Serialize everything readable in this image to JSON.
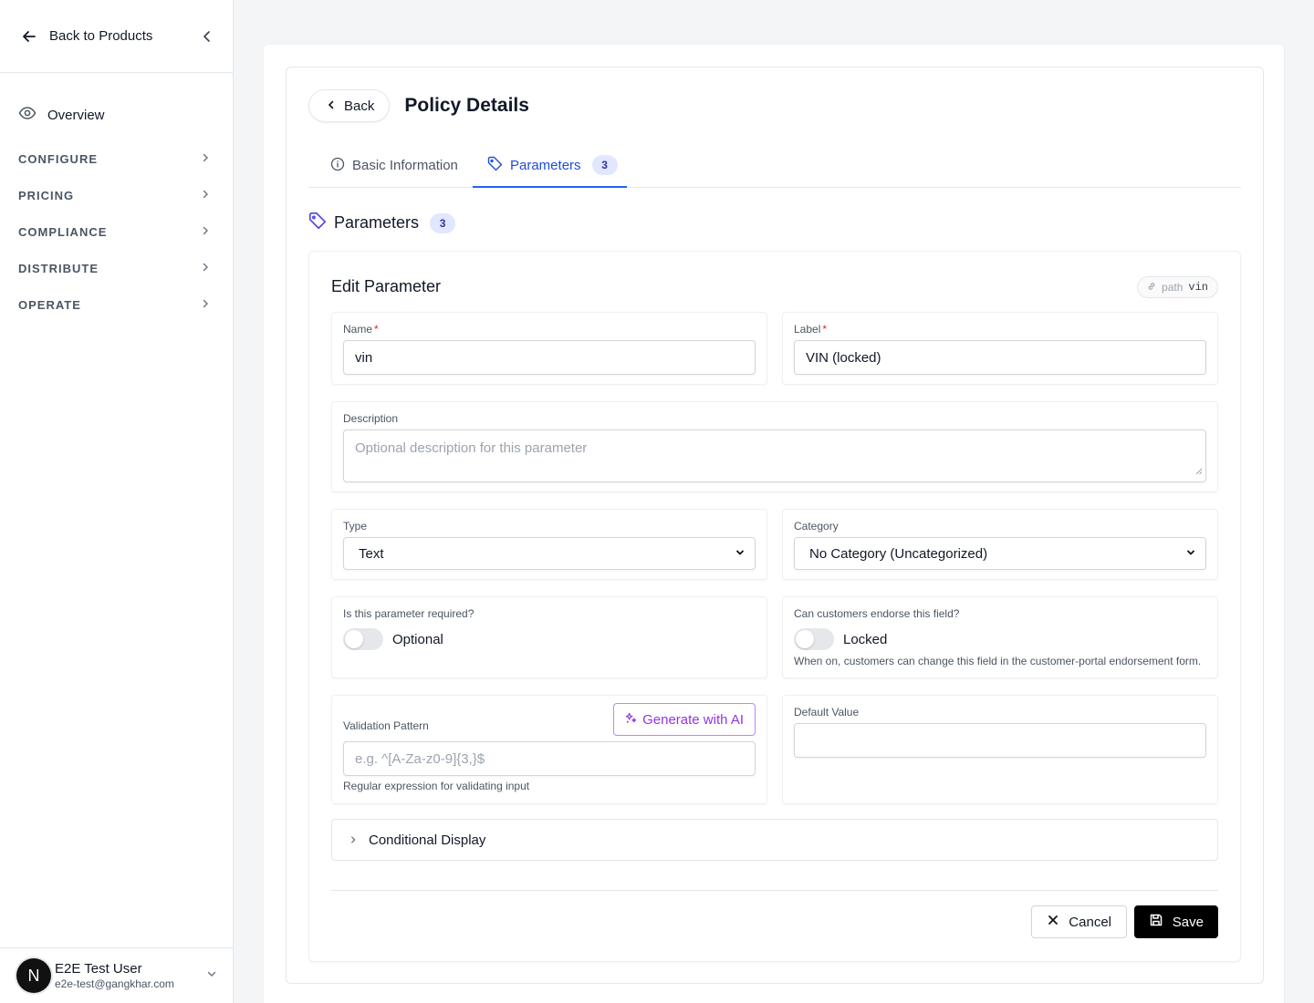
{
  "sidebar": {
    "back_label": "Back to Products",
    "overview_label": "Overview",
    "sections": [
      {
        "label": "CONFIGURE"
      },
      {
        "label": "PRICING"
      },
      {
        "label": "COMPLIANCE"
      },
      {
        "label": "DISTRIBUTE"
      },
      {
        "label": "OPERATE"
      }
    ],
    "user": {
      "initial": "N",
      "name": "E2E Test User",
      "email": "e2e-test@gangkhar.com"
    }
  },
  "header": {
    "back_label": "Back",
    "title": "Policy Details"
  },
  "tabs": [
    {
      "label": "Basic Information",
      "icon": "info-icon",
      "active": false
    },
    {
      "label": "Parameters",
      "icon": "tag-icon",
      "count": "3",
      "active": true
    }
  ],
  "section": {
    "title": "Parameters",
    "count": "3"
  },
  "editor": {
    "title": "Edit Parameter",
    "path_label": "path",
    "path_value": "vin",
    "name": {
      "label": "Name",
      "value": "vin"
    },
    "label": {
      "label": "Label",
      "value": "VIN (locked)"
    },
    "description": {
      "label": "Description",
      "placeholder": "Optional description for this parameter"
    },
    "type": {
      "label": "Type",
      "value": "Text"
    },
    "category": {
      "label": "Category",
      "value": "No Category (Uncategorized)"
    },
    "required": {
      "label": "Is this parameter required?",
      "state": "Optional"
    },
    "endorse": {
      "label": "Can customers endorse this field?",
      "state": "Locked",
      "hint": "When on, customers can change this field in the customer-portal endorsement form."
    },
    "validation": {
      "label": "Validation Pattern",
      "placeholder": "e.g. ^[A-Za-z0-9]{3,}$",
      "hint": "Regular expression for validating input",
      "ai_label": "Generate with AI"
    },
    "default_value": {
      "label": "Default Value",
      "value": ""
    },
    "conditional_label": "Conditional Display",
    "cancel_label": "Cancel",
    "save_label": "Save"
  },
  "colors": {
    "accent": "#2563eb",
    "ai_purple": "#9333ea",
    "badge_bg": "#e0e7ff",
    "required_star": "#dc2626"
  }
}
